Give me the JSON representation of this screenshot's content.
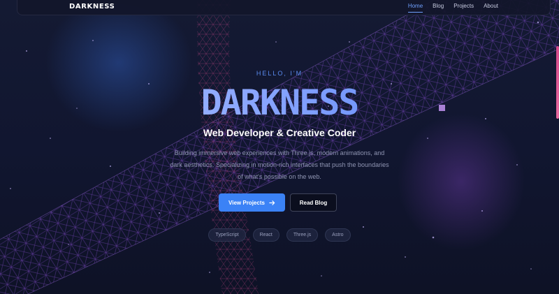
{
  "nav": {
    "brand": "DARKNESS",
    "links": [
      {
        "label": "Home",
        "active": true
      },
      {
        "label": "Blog",
        "active": false
      },
      {
        "label": "Projects",
        "active": false
      },
      {
        "label": "About",
        "active": false
      }
    ]
  },
  "hero": {
    "eyebrow": "HELLO, I'M",
    "title": "DARKNESS",
    "subtitle": "Web Developer & Creative Coder",
    "description": "Building immersive web experiences with Three.js, modern animations, and dark aesthetics. Specializing in motion-rich interfaces that push the boundaries of what's possible on the web.",
    "primary_cta": "View Projects",
    "secondary_cta": "Read Blog",
    "tags": [
      "TypeScript",
      "React",
      "Three.js",
      "Astro"
    ]
  },
  "icons": {
    "primary_cta_icon": "arrow-right-icon"
  },
  "colors": {
    "accent": "#3b82f6",
    "title_gradient_start": "#b6c8ff",
    "title_gradient_end": "#4d7cf3",
    "background": "#0f1325",
    "mesh": "#8a4fd6",
    "scroll_accent": "#d44a8a"
  }
}
